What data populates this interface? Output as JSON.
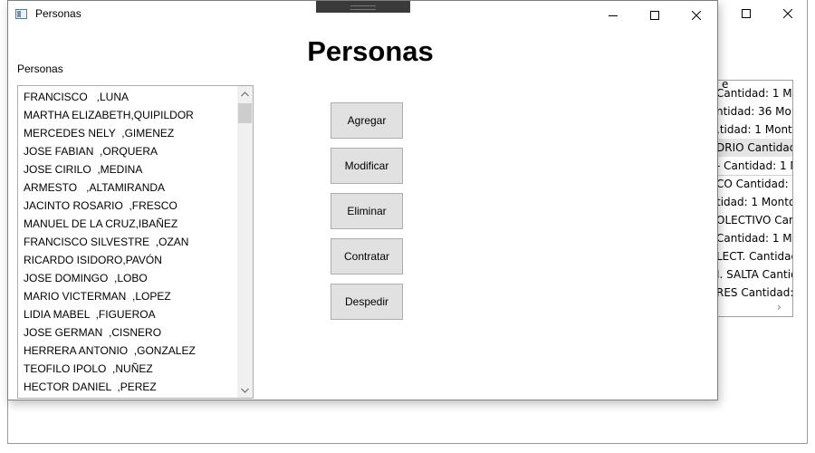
{
  "window": {
    "title": "Personas",
    "heading": "Personas",
    "list_label": "Personas"
  },
  "personas": [
    "FRANCISCO   ,LUNA",
    "MARTHA ELIZABETH,QUIPILDOR",
    "MERCEDES NELY  ,GIMENEZ",
    "JOSE FABIAN  ,ORQUERA",
    "JOSE CIRILO  ,MEDINA",
    "ARMESTO   ,ALTAMIRANDA",
    "JACINTO ROSARIO  ,FRESCO",
    "MANUEL DE LA CRUZ,IBAÑEZ",
    "FRANCISCO SILVESTRE  ,OZAN",
    "RICARDO ISIDORO,PAVÓN",
    "JOSE DOMINGO  ,LOBO",
    "MARIO VICTERMAN  ,LOPEZ",
    "LIDIA MABEL  ,FIGUEROA",
    "JOSE GERMAN  ,CISNERO",
    "HERRERA ANTONIO  ,GONZALEZ",
    "TEOFILO IPOLO  ,NUÑEZ",
    "HECTOR DANIEL  ,PEREZ"
  ],
  "buttons": {
    "agregar": "Agregar",
    "modificar": "Modificar",
    "eliminar": "Eliminar",
    "contratar": "Contratar",
    "despedir": "Despedir"
  },
  "background_window": {
    "header_fragment": "e",
    "items": [
      " Cantidad: 1 Mo",
      "ntidad: 36 Mon",
      ",tidad: 1 Monto",
      "DRIO Cantidad",
      "- Cantidad: 1 M",
      "CO Cantidad:",
      "tidad: 1 Monto",
      "OLECTIVO Cant",
      " Cantidad: 1 M",
      "LECT. Cantidad",
      "I. SALTA Cantic",
      "RES Cantidad:"
    ]
  },
  "icons": {
    "minimize": "minimize-icon",
    "maximize": "maximize-icon",
    "close": "close-icon",
    "app": "app-icon"
  }
}
